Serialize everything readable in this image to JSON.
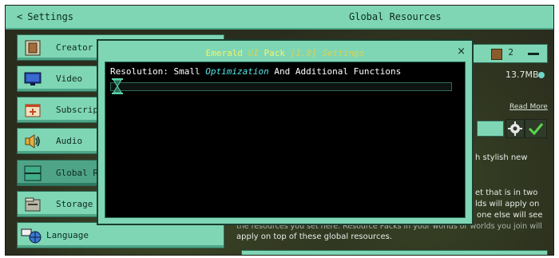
{
  "header": {
    "back_label": "Settings",
    "title": "Global Resources"
  },
  "sidebar": {
    "items": [
      {
        "label": "Creator",
        "icon": "creator-book-icon"
      },
      {
        "label": "Video",
        "icon": "monitor-icon"
      },
      {
        "label": "Subscrip",
        "icon": "subscription-icon"
      },
      {
        "label": "Audio",
        "icon": "speaker-icon"
      },
      {
        "label": "Global R",
        "icon": "global-resources-icon",
        "selected": true
      },
      {
        "label": "Storage",
        "icon": "storage-icon"
      },
      {
        "label": "Language",
        "icon": "language-globe-icon"
      }
    ]
  },
  "right_panel": {
    "pack_count": "2",
    "size": "13.7MB",
    "read_more": "Read More",
    "desc_line1": "h stylish new",
    "desc_line2": "et that is in two",
    "desc_line3": "lds will apply on",
    "desc_line4": "one else will see",
    "desc_line5": "the resources you set here. Resource Packs in your worlds or worlds you join will",
    "desc_line6": "apply on top of these global resources."
  },
  "dialog": {
    "title_part1": "Emerald",
    "title_part2": "UI",
    "title_part3": "Pack",
    "title_part4": "[1.8] Settings",
    "close_label": "×",
    "resolution_prefix": "Resolution: Small",
    "resolution_highlight": "Optimization",
    "resolution_suffix": "And Additional Functions",
    "progress": 0.0
  },
  "colors": {
    "accent": "#7fd6b5",
    "accent_dark": "#4fa487",
    "title_yellow": "#f4f36a",
    "optimization_cyan": "#55e6e6"
  }
}
